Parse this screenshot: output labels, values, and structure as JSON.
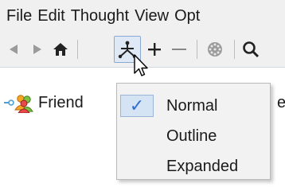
{
  "menubar": {
    "items": [
      "File",
      "Edit",
      "Thought",
      "View",
      "Opt"
    ]
  },
  "toolbar": {
    "buttons": [
      "back-arrow-icon",
      "forward-arrow-icon",
      "home-icon",
      "layout-icon",
      "plus-icon",
      "minus-icon",
      "globe-icon",
      "search-icon"
    ]
  },
  "tree": {
    "node_label": "Friend",
    "node_label_right": "el"
  },
  "layout_menu": {
    "items": [
      {
        "label": "Normal",
        "checked": true
      },
      {
        "label": "Outline",
        "checked": false
      },
      {
        "label": "Expanded",
        "checked": false
      }
    ],
    "check_glyph": "✓"
  },
  "colors": {
    "accent": "#2f6fcf",
    "selection": "#d5e4f5",
    "menu_bg": "#f2f2f2"
  }
}
